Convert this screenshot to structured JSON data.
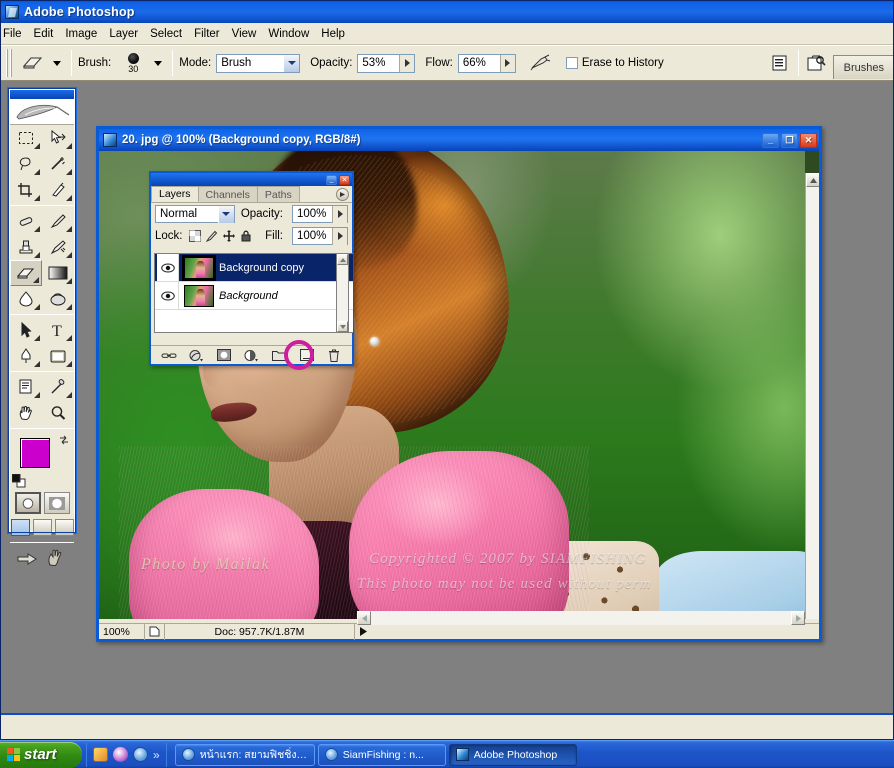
{
  "app": {
    "title": "Adobe Photoshop",
    "menu": [
      "File",
      "Edit",
      "Image",
      "Layer",
      "Select",
      "Filter",
      "View",
      "Window",
      "Help"
    ]
  },
  "options_bar": {
    "tool_icon": "eraser-icon",
    "brush_label": "Brush:",
    "brush_size": "30",
    "mode_label": "Mode:",
    "mode_value": "Brush",
    "opacity_label": "Opacity:",
    "opacity_value": "53%",
    "flow_label": "Flow:",
    "flow_value": "66%",
    "airbrush_icon": "airbrush-icon",
    "erase_to_history_label": "Erase to History",
    "erase_to_history_checked": false,
    "palette_well_icons": [
      "brushes-palette-icon",
      "file-browser-icon"
    ],
    "brushes_tab_label": "Brushes"
  },
  "toolbox": {
    "tools": [
      "marquee-tool",
      "move-tool",
      "lasso-tool",
      "magic-wand-tool",
      "crop-tool",
      "slice-tool",
      "healing-brush-tool",
      "brush-tool",
      "clone-stamp-tool",
      "history-brush-tool",
      "eraser-tool",
      "gradient-tool",
      "blur-tool",
      "dodge-tool",
      "path-selection-tool",
      "type-tool",
      "pen-tool",
      "shape-tool",
      "notes-tool",
      "eyedropper-tool",
      "hand-tool",
      "zoom-tool"
    ],
    "selected_tool": "eraser-tool",
    "foreground_color": "#cc00cc",
    "background_color": "#ffffff",
    "mode_buttons": [
      "standard-mask-mode",
      "quick-mask-mode"
    ],
    "screen_modes": [
      "standard-screen-mode",
      "full-screen-menubar-mode",
      "full-screen-mode"
    ],
    "jump_buttons": [
      "jump-to-imageready"
    ]
  },
  "document": {
    "title": "20. jpg @ 100% (Background copy, RGB/8#)",
    "window_buttons": [
      "minimize",
      "maximize",
      "close"
    ],
    "status": {
      "zoom": "100%",
      "doc_info": "Doc: 957.7K/1.87M"
    },
    "watermarks": {
      "author": "Photo by Mailak",
      "copyright_line1": "Copyrighted © 2007 by SIAMFISHING",
      "copyright_line2": "This photo may not be used without perm"
    }
  },
  "layers_palette": {
    "tabs": [
      "Layers",
      "Channels",
      "Paths"
    ],
    "active_tab": "Layers",
    "blend_mode": "Normal",
    "opacity_label": "Opacity:",
    "opacity_value": "100%",
    "lock_label": "Lock:",
    "lock_icons": [
      "lock-transparency-icon",
      "lock-image-icon",
      "lock-position-icon",
      "lock-all-icon"
    ],
    "fill_label": "Fill:",
    "fill_value": "100%",
    "layers": [
      {
        "name": "Background copy",
        "visible": true,
        "selected": true,
        "locked": false
      },
      {
        "name": "Background",
        "visible": true,
        "selected": false,
        "locked": true
      }
    ],
    "bottom_buttons": [
      "link-layers-icon",
      "layer-style-icon",
      "layer-mask-icon",
      "adjustment-layer-icon",
      "new-group-icon",
      "new-layer-icon",
      "delete-layer-icon"
    ],
    "highlighted_button": "new-layer-icon",
    "highlight_color": "#cc1f9e"
  },
  "taskbar": {
    "start_label": "start",
    "quick_launch": [
      "show-desktop-icon",
      "media-player-icon",
      "internet-explorer-icon"
    ],
    "chevron": "»",
    "tasks": [
      {
        "label": "หน้าแรก: สยามฟิชชิ่ง -...",
        "icon": "internet-explorer-icon",
        "active": false
      },
      {
        "label": "SiamFishing : n...",
        "icon": "internet-explorer-icon",
        "active": false
      },
      {
        "label": "Adobe Photoshop",
        "icon": "photoshop-icon",
        "active": true
      }
    ]
  }
}
